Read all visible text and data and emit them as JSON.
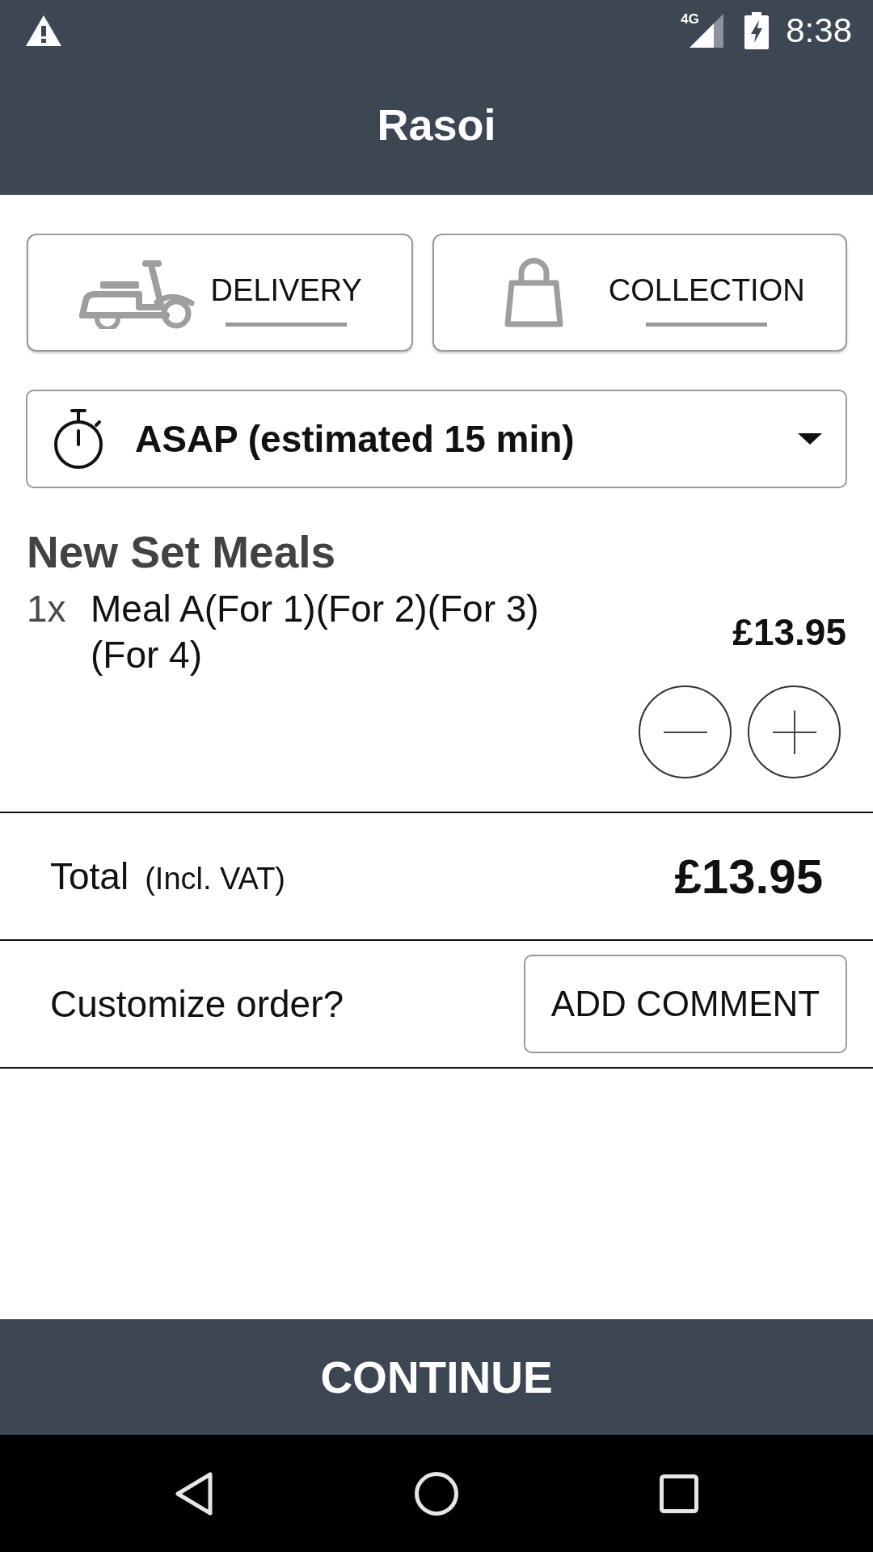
{
  "status_bar": {
    "network": "4G",
    "time": "8:38"
  },
  "header": {
    "title": "Rasoi"
  },
  "order_types": [
    {
      "kind": "delivery",
      "label": "DELIVERY"
    },
    {
      "kind": "collection",
      "label": "COLLECTION"
    }
  ],
  "time_select": {
    "value": "ASAP (estimated 15 min)"
  },
  "sections": [
    {
      "title": "New Set Meals",
      "items": [
        {
          "quantity": "1x",
          "name": "Meal A(For 1)(For 2)(For 3)(For 4)",
          "price": "£13.95"
        }
      ]
    }
  ],
  "total": {
    "label": "Total",
    "note": "(Incl. VAT)",
    "amount": "£13.95"
  },
  "comment": {
    "prompt": "Customize order?",
    "button": "ADD COMMENT"
  },
  "continue_button": {
    "label": "CONTINUE"
  }
}
